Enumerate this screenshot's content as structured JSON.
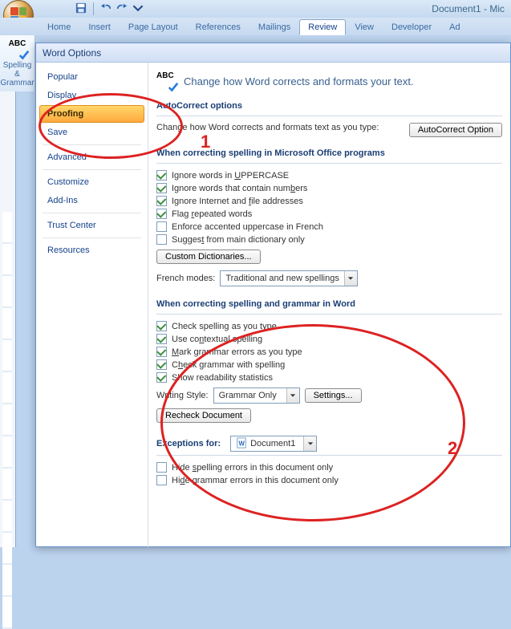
{
  "titlebar": "Document1 - Mic",
  "ribbon": {
    "tabs": [
      "Home",
      "Insert",
      "Page Layout",
      "References",
      "Mailings",
      "Review",
      "View",
      "Developer",
      "Ad"
    ],
    "active": "Review"
  },
  "group": {
    "label": "Spelling & Grammar"
  },
  "dialog": {
    "title": "Word Options",
    "nav": [
      "Popular",
      "Display",
      "Proofing",
      "Save",
      "Advanced",
      "Customize",
      "Add-Ins",
      "Trust Center",
      "Resources"
    ],
    "selected": "Proofing",
    "header": "Change how Word corrects and formats your text.",
    "autocorrect": {
      "title": "AutoCorrect options",
      "text": "Change how Word corrects and formats text as you type:",
      "button": "AutoCorrect Option"
    },
    "spell_office": {
      "title": "When correcting spelling in Microsoft Office programs",
      "items": [
        {
          "label": "Ignore words in UPPERCASE",
          "checked": true,
          "u": "U"
        },
        {
          "label": "Ignore words that contain numbers",
          "checked": true,
          "u": "b"
        },
        {
          "label": "Ignore Internet and file addresses",
          "checked": true,
          "u": "f"
        },
        {
          "label": "Flag repeated words",
          "checked": true,
          "u": "r"
        },
        {
          "label": "Enforce accented uppercase in French",
          "checked": false
        },
        {
          "label": "Suggest from main dictionary only",
          "checked": false,
          "u": "t"
        }
      ],
      "dict_btn": "Custom Dictionaries...",
      "french_label": "French modes:",
      "french_value": "Traditional and new spellings"
    },
    "spell_word": {
      "title": "When correcting spelling and grammar in Word",
      "items": [
        {
          "label": "Check spelling as you type",
          "checked": true,
          "u": "P"
        },
        {
          "label": "Use contextual spelling",
          "checked": true,
          "u": "n"
        },
        {
          "label": "Mark grammar errors as you type",
          "checked": true,
          "u": "M"
        },
        {
          "label": "Check grammar with spelling",
          "checked": true,
          "u": "h"
        },
        {
          "label": "Show readability statistics",
          "checked": true,
          "u": "L"
        }
      ],
      "style_label": "Writing Style:",
      "style_value": "Grammar Only",
      "settings_btn": "Settings...",
      "recheck_btn": "Recheck Document"
    },
    "exceptions": {
      "title": "Exceptions for:",
      "doc": "Document1",
      "items": [
        {
          "label": "Hide spelling errors in this document only",
          "checked": false,
          "u": "s"
        },
        {
          "label": "Hide grammar errors in this document only",
          "checked": false,
          "u": "d"
        }
      ]
    }
  },
  "annotations": {
    "num1": "1",
    "num2": "2"
  }
}
